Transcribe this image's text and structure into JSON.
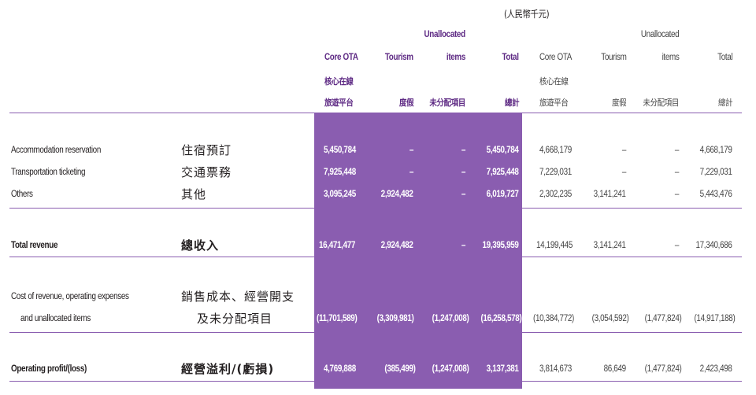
{
  "currency_note": "(人民幣千元)",
  "headers": {
    "unallocated_1": "Unallocated",
    "items_1": "items",
    "core_ota_1": "Core OTA",
    "tourism_1": "Tourism",
    "total_1": "Total",
    "core_ota_zh_1": "核心在線",
    "travel_platform_zh_1": "旅遊平台",
    "tourism_zh_1": "度假",
    "unallocated_zh_1": "未分配項目",
    "total_zh_1": "總計",
    "unallocated_2": "Unallocated",
    "items_2": "items",
    "core_ota_2": "Core OTA",
    "tourism_2": "Tourism",
    "total_2": "Total",
    "core_ota_zh_2": "核心在線",
    "travel_platform_zh_2": "旅遊平台",
    "tourism_zh_2": "度假",
    "unallocated_zh_2": "未分配項目",
    "total_zh_2": "總計"
  },
  "rows": {
    "accommodation": {
      "en": "Accommodation reservation",
      "zh": "住宿預訂",
      "v": [
        "5,450,784",
        "–",
        "–",
        "5,450,784",
        "4,668,179",
        "–",
        "–",
        "4,668,179"
      ]
    },
    "transportation": {
      "en": "Transportation ticketing",
      "zh": "交通票務",
      "v": [
        "7,925,448",
        "–",
        "–",
        "7,925,448",
        "7,229,031",
        "–",
        "–",
        "7,229,031"
      ]
    },
    "others": {
      "en": "Others",
      "zh": "其他",
      "v": [
        "3,095,245",
        "2,924,482",
        "–",
        "6,019,727",
        "2,302,235",
        "3,141,241",
        "–",
        "5,443,476"
      ]
    },
    "total_revenue": {
      "en": "Total revenue",
      "zh": "總收入",
      "v": [
        "16,471,477",
        "2,924,482",
        "–",
        "19,395,959",
        "14,199,445",
        "3,141,241",
        "–",
        "17,340,686"
      ]
    },
    "cost": {
      "en_1": "Cost of revenue, operating expenses",
      "en_2": "and unallocated items",
      "zh_1": "銷售成本、經營開支",
      "zh_2": "及未分配項目",
      "v": [
        "(11,701,589)",
        "(3,309,981)",
        "(1,247,008)",
        "(16,258,578)",
        "(10,384,772)",
        "(3,054,592)",
        "(1,477,824)",
        "(14,917,188)"
      ]
    },
    "operating": {
      "en": "Operating profit/(loss)",
      "zh": "經營溢利/(虧損)",
      "v": [
        "4,769,888",
        "(385,499)",
        "(1,247,008)",
        "3,137,381",
        "3,814,673",
        "86,649",
        "(1,477,824)",
        "2,423,498"
      ]
    }
  }
}
